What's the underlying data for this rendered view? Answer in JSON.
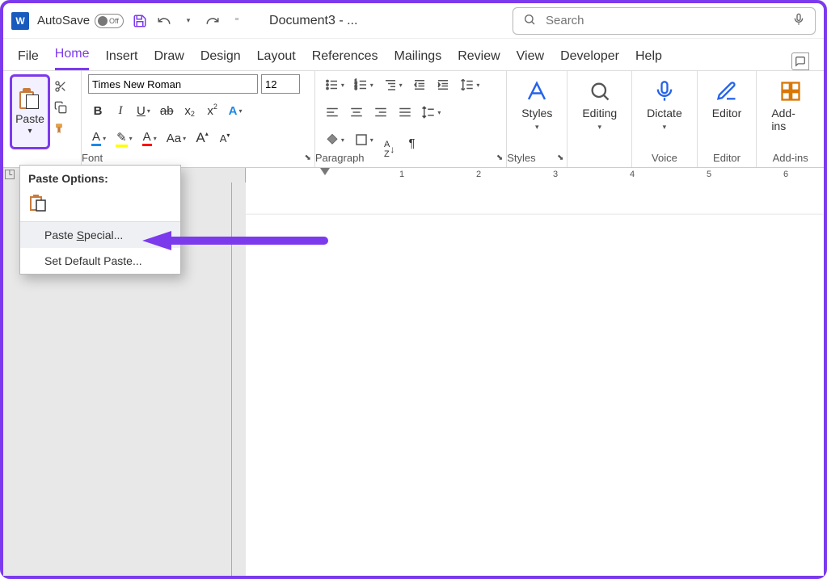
{
  "titlebar": {
    "app_icon_letter": "W",
    "autosave_label": "AutoSave",
    "autosave_state": "Off",
    "document_name": "Document3  - ...",
    "search_placeholder": "Search"
  },
  "tabs": [
    "File",
    "Home",
    "Insert",
    "Draw",
    "Design",
    "Layout",
    "References",
    "Mailings",
    "Review",
    "View",
    "Developer",
    "Help"
  ],
  "active_tab": "Home",
  "ribbon": {
    "clipboard": {
      "paste_label": "Paste"
    },
    "font": {
      "font_name": "Times New Roman",
      "font_size": "12",
      "group_label": "Font",
      "btn_bold": "B",
      "btn_italic": "I",
      "btn_underline": "U",
      "btn_strike": "ab",
      "btn_sub": "x",
      "btn_sup": "x",
      "btn_case": "Aa",
      "btn_grow": "A",
      "btn_shrink": "A",
      "btn_clear": "A",
      "btn_color": "A",
      "btn_a": "A"
    },
    "paragraph": {
      "group_label": "Paragraph"
    },
    "styles": {
      "label": "Styles",
      "group_label": "Styles"
    },
    "editing": {
      "label": "Editing"
    },
    "dictate": {
      "label": "Dictate",
      "group_label": "Voice"
    },
    "editor": {
      "label": "Editor",
      "group_label": "Editor"
    },
    "addins": {
      "label": "Add-ins",
      "group_label": "Add-ins"
    }
  },
  "ruler_numbers": [
    "1",
    "2",
    "3",
    "4",
    "5",
    "6"
  ],
  "paste_menu": {
    "header": "Paste Options:",
    "items": [
      {
        "label_pre": "Paste ",
        "hotkey": "S",
        "label_post": "pecial..."
      },
      {
        "label_pre": "Set ",
        "hotkey": "",
        "label_post": "Default Paste..."
      }
    ]
  },
  "annotation": {
    "arrow_color": "#7c3aed",
    "paste_highlight_color": "#7c3aed"
  }
}
